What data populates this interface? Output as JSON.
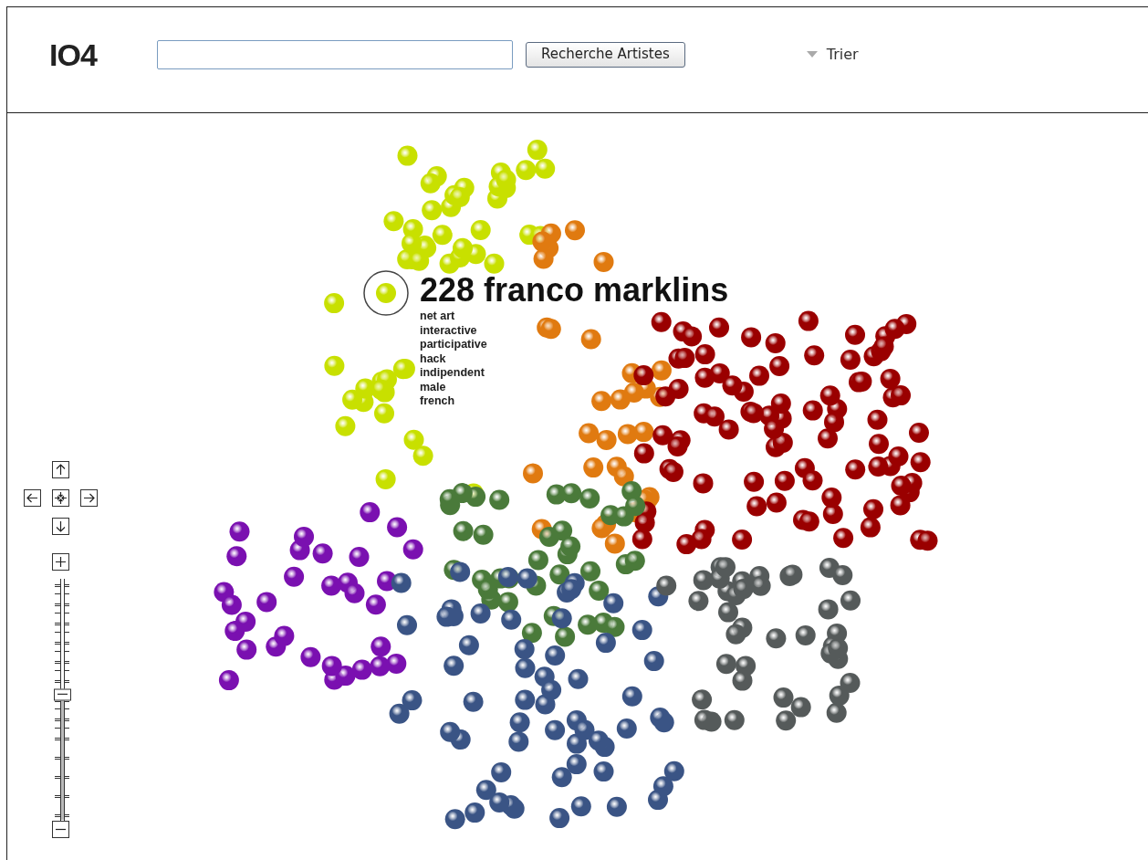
{
  "header": {
    "logo": "IO4",
    "search_button": "Recherche Artistes",
    "sort_menu": {
      "label": "Trier"
    }
  },
  "map": {
    "selected_artist": {
      "title": "228 franco marklins",
      "tags": [
        "net art",
        "interactive",
        "participative",
        "hack",
        "indipendent",
        "male",
        "french"
      ]
    },
    "zoom": {
      "level": 0.52
    }
  }
}
